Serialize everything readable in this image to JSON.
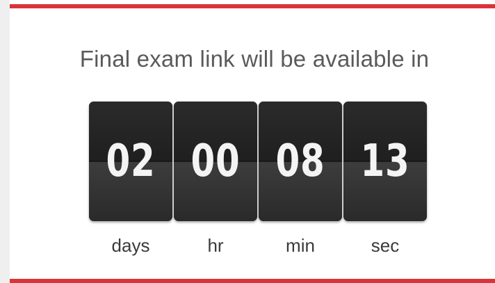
{
  "colors": {
    "accent": "#d9343a",
    "tile": "#232323",
    "digit": "#f4f4f4",
    "headline": "#5a5a5a"
  },
  "countdown": {
    "headline": "Final exam link will be available in",
    "units": [
      {
        "value": "02",
        "label": "days"
      },
      {
        "value": "00",
        "label": "hr"
      },
      {
        "value": "08",
        "label": "min"
      },
      {
        "value": "13",
        "label": "sec"
      }
    ]
  }
}
